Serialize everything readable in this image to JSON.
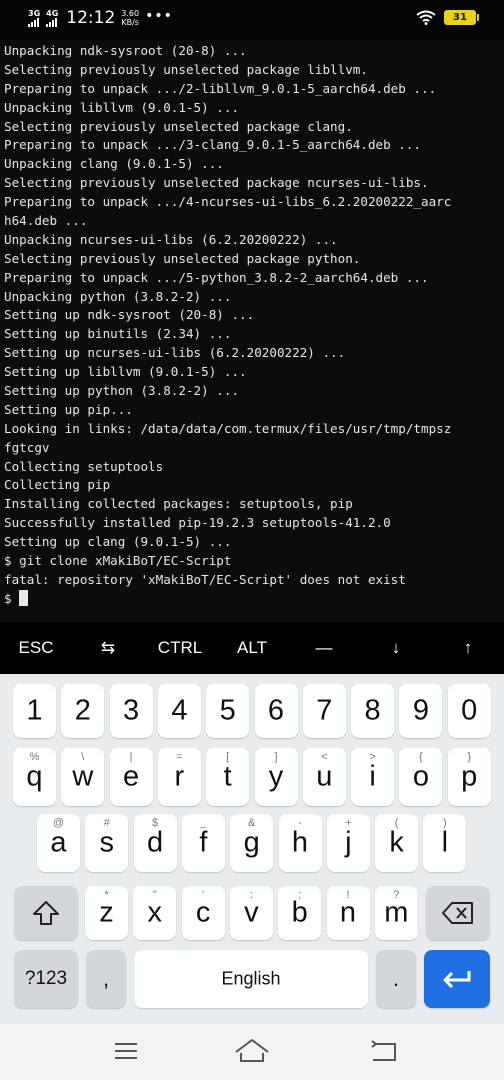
{
  "status_bar": {
    "net1": "3G",
    "net2": "4G",
    "time": "12:12",
    "speed_value": "3.60",
    "speed_unit": "KB/s",
    "more": "•••",
    "battery_level": "31",
    "battery_color": "#e8d21b"
  },
  "terminal": {
    "lines": [
      "Unpacking ndk-sysroot (20-8) ...",
      "Selecting previously unselected package libllvm.",
      "Preparing to unpack .../2-libllvm_9.0.1-5_aarch64.deb ...",
      "Unpacking libllvm (9.0.1-5) ...",
      "Selecting previously unselected package clang.",
      "Preparing to unpack .../3-clang_9.0.1-5_aarch64.deb ...",
      "Unpacking clang (9.0.1-5) ...",
      "Selecting previously unselected package ncurses-ui-libs.",
      "Preparing to unpack .../4-ncurses-ui-libs_6.2.20200222_aarc",
      "h64.deb ...",
      "Unpacking ncurses-ui-libs (6.2.20200222) ...",
      "Selecting previously unselected package python.",
      "Preparing to unpack .../5-python_3.8.2-2_aarch64.deb ...",
      "Unpacking python (3.8.2-2) ...",
      "Setting up ndk-sysroot (20-8) ...",
      "Setting up binutils (2.34) ...",
      "Setting up ncurses-ui-libs (6.2.20200222) ...",
      "Setting up libllvm (9.0.1-5) ...",
      "Setting up python (3.8.2-2) ...",
      "Setting up pip...",
      "Looking in links: /data/data/com.termux/files/usr/tmp/tmpsz",
      "fgtcgv",
      "Collecting setuptools",
      "Collecting pip",
      "Installing collected packages: setuptools, pip",
      "Successfully installed pip-19.2.3 setuptools-41.2.0",
      "Setting up clang (9.0.1-5) ...",
      "$ git clone xMakiBoT/EC-Script",
      "fatal: repository 'xMakiBoT/EC-Script' does not exist"
    ],
    "prompt": "$ "
  },
  "extra_keys": [
    {
      "label": "ESC",
      "name": "esc-key"
    },
    {
      "label": "⇆",
      "name": "tab-key"
    },
    {
      "label": "CTRL",
      "name": "ctrl-key"
    },
    {
      "label": "ALT",
      "name": "alt-key"
    },
    {
      "label": "—",
      "name": "dash-key"
    },
    {
      "label": "↓",
      "name": "arrow-down-key"
    },
    {
      "label": "↑",
      "name": "arrow-up-key"
    }
  ],
  "keyboard": {
    "row1": [
      {
        "main": "1"
      },
      {
        "main": "2"
      },
      {
        "main": "3"
      },
      {
        "main": "4"
      },
      {
        "main": "5"
      },
      {
        "main": "6"
      },
      {
        "main": "7"
      },
      {
        "main": "8"
      },
      {
        "main": "9"
      },
      {
        "main": "0"
      }
    ],
    "row2": [
      {
        "main": "q",
        "hint": "%"
      },
      {
        "main": "w",
        "hint": "\\"
      },
      {
        "main": "e",
        "hint": "|"
      },
      {
        "main": "r",
        "hint": "="
      },
      {
        "main": "t",
        "hint": "["
      },
      {
        "main": "y",
        "hint": "]"
      },
      {
        "main": "u",
        "hint": "<"
      },
      {
        "main": "i",
        "hint": ">"
      },
      {
        "main": "o",
        "hint": "{"
      },
      {
        "main": "p",
        "hint": "}"
      }
    ],
    "row3": [
      {
        "main": "a",
        "hint": "@"
      },
      {
        "main": "s",
        "hint": "#"
      },
      {
        "main": "d",
        "hint": "$"
      },
      {
        "main": "f",
        "hint": "_"
      },
      {
        "main": "g",
        "hint": "&"
      },
      {
        "main": "h",
        "hint": "-"
      },
      {
        "main": "j",
        "hint": "+"
      },
      {
        "main": "k",
        "hint": "("
      },
      {
        "main": "l",
        "hint": ")"
      }
    ],
    "row4": [
      {
        "main": "z",
        "hint": "*"
      },
      {
        "main": "x",
        "hint": "\""
      },
      {
        "main": "c",
        "hint": "'"
      },
      {
        "main": "v",
        "hint": ":"
      },
      {
        "main": "b",
        "hint": ";"
      },
      {
        "main": "n",
        "hint": "!"
      },
      {
        "main": "m",
        "hint": "?"
      }
    ],
    "sym_label": "?123",
    "comma_label": ",",
    "space_label": "English",
    "period_label": ".",
    "enter_color": "#1f6fe0",
    "icons": {
      "shift": "shift-icon",
      "backspace": "backspace-icon",
      "enter": "enter-icon"
    }
  },
  "nav_bar": {
    "icons": [
      "menu-icon",
      "home-icon",
      "back-icon"
    ]
  }
}
